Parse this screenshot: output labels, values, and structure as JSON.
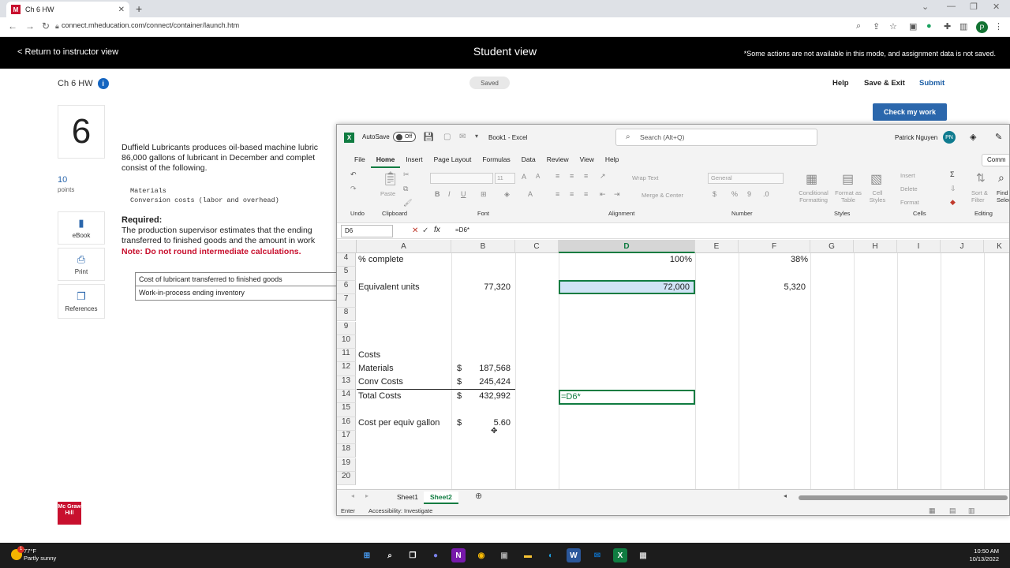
{
  "browser": {
    "tab_title": "Ch 6 HW",
    "url": "connect.mheducation.com/connect/container/launch.htm",
    "profile_initial": "P"
  },
  "instructor_bar": {
    "return_link": "< Return to instructor view",
    "mode_title": "Student view",
    "notice": "*Some actions are not available in this mode, and assignment data is not saved."
  },
  "header": {
    "assignment": "Ch 6 HW",
    "saved_badge": "Saved",
    "help": "Help",
    "save_exit": "Save & Exit",
    "submit": "Submit",
    "check": "Check my work"
  },
  "question": {
    "number": "6",
    "points": "10",
    "points_label": "points",
    "text": "Duffield Lubricants produces oil-based machine lubric 86,000 gallons of lubricant in December and complet consist of the following.",
    "mono_rows": [
      "Materials",
      "Conversion costs (labor and overhead)"
    ],
    "required_heading": "Required:",
    "required_text": "The production supervisor estimates that the ending transferred to finished goods and the amount in work",
    "note": "Note: Do not round intermediate calculations.",
    "answer_rows": [
      "Cost of lubricant transferred to finished goods",
      "Work-in-process ending inventory"
    ]
  },
  "sidebar": {
    "ebook": "eBook",
    "print": "Print",
    "references": "References"
  },
  "brand": {
    "logo_text": "Mc Graw Hill"
  },
  "excel": {
    "autosave": "AutoSave",
    "autosave_state": "Off",
    "book_title": "Book1 - Excel",
    "search_placeholder": "Search (Alt+Q)",
    "user": "Patrick Nguyen",
    "user_initials": "PN",
    "comments": "Comm",
    "menu": [
      "File",
      "Home",
      "Insert",
      "Page Layout",
      "Formulas",
      "Data",
      "Review",
      "View",
      "Help"
    ],
    "active_menu": "Home",
    "ribbon_groups": [
      "Undo",
      "Clipboard",
      "Font",
      "Alignment",
      "Number",
      "Styles",
      "Cells",
      "Editing"
    ],
    "ribbon_items": {
      "paste": "Paste",
      "font_name": "",
      "font_size": "11",
      "wrap": "Wrap Text",
      "merge": "Merge & Center",
      "num_format": "General",
      "cond": "Conditional Formatting",
      "fmt_table": "Format as Table",
      "cell_styles": "Cell Styles",
      "insert": "Insert",
      "delete": "Delete",
      "format": "Format",
      "sort": "Sort & Filter",
      "find": "Find & Select"
    },
    "name_box": "D6",
    "formula": "=D6*",
    "columns": [
      "A",
      "B",
      "C",
      "D",
      "E",
      "F",
      "G",
      "H",
      "I",
      "J",
      "K"
    ],
    "rows": [
      "4",
      "5",
      "6",
      "7",
      "8",
      "9",
      "10",
      "11",
      "12",
      "13",
      "14",
      "15",
      "16",
      "17",
      "18",
      "19",
      "20"
    ],
    "cells": {
      "a4": "% complete",
      "d4": "100%",
      "f4": "38%",
      "a6": "Equivalent units",
      "b6": "77,320",
      "d6": "72,000",
      "f6": "5,320",
      "a11": "Costs",
      "a12": "Materials",
      "b12_cur": "$",
      "b12": "187,568",
      "a13": "Conv Costs",
      "b13_cur": "$",
      "b13": "245,424",
      "a14": "Total Costs",
      "b14_cur": "$",
      "b14": "432,992",
      "d14": "=D6*",
      "a16": "Cost per equiv gallon",
      "b16_cur": "$",
      "b16": "5.60"
    },
    "sheets": [
      "Sheet1",
      "Sheet2"
    ],
    "active_sheet": "Sheet2",
    "status_mode": "Enter",
    "accessibility": "Accessibility: Investigate"
  },
  "taskbar": {
    "temp": "77°F",
    "weather": "Partly sunny",
    "time": "10:50 AM",
    "date": "10/13/2022",
    "weather_badge": "1"
  }
}
